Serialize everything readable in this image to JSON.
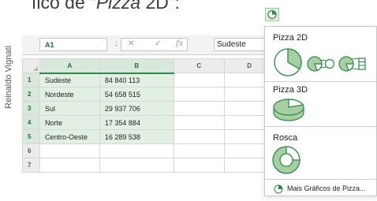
{
  "heading": {
    "prefix": "fico de “",
    "italic": "Pizza",
    "suffix": " 2D”:"
  },
  "side_author": "Reinaldo Vignati",
  "formula_bar": {
    "name_box": "A1",
    "separator": ":",
    "cancel_symbol": "✕",
    "confirm_symbol": "✓",
    "function_symbol": "fx",
    "value": "Sudeste"
  },
  "columns": [
    "A",
    "B",
    "C",
    "D"
  ],
  "rows": [
    {
      "num": "1",
      "a": "Sudeste",
      "b": "84 840 113"
    },
    {
      "num": "2",
      "a": "Nordeste",
      "b": "54 658 515"
    },
    {
      "num": "3",
      "a": "Sul",
      "b": "29 937 706"
    },
    {
      "num": "4",
      "a": "Norte",
      "b": "17 354 884"
    },
    {
      "num": "5",
      "a": "Centro-Oeste",
      "b": "16 289 538"
    },
    {
      "num": "6",
      "a": "",
      "b": ""
    },
    {
      "num": "7",
      "a": "",
      "b": ""
    }
  ],
  "chart_menu": {
    "section_2d": "Pizza 2D",
    "section_3d": "Pizza 3D",
    "section_donut": "Rosca",
    "more_label": "Mais Gráficos de Pizza...",
    "accent": "#2b8a48",
    "fill": "#a7cfa3"
  },
  "icons": [
    "pie-chart-icon",
    "pie-2d-icon",
    "pie-of-pie-icon",
    "bar-of-pie-icon",
    "pie-3d-icon",
    "donut-icon"
  ]
}
